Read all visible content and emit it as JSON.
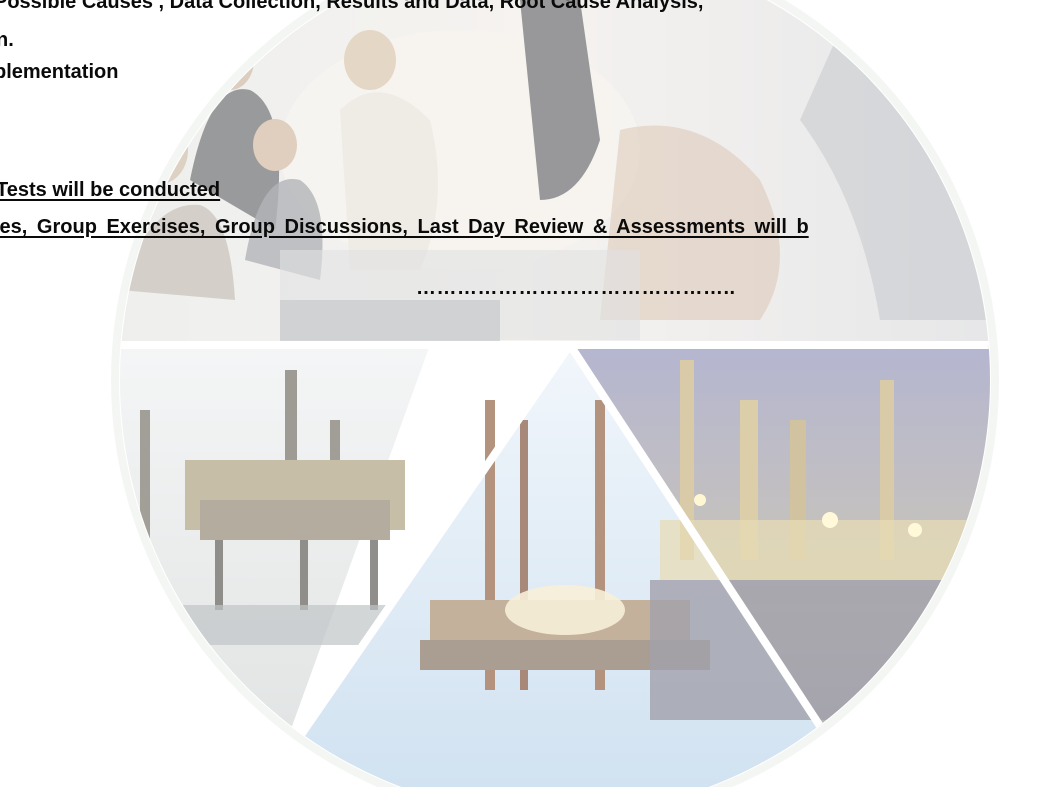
{
  "document": {
    "lines": [
      "Possible Causes , Data Collection, Results and Data, Root Cause Analysis,",
      "n.",
      "plementation",
      "Tests will be conducted",
      "ies, Group Exercises, Group Discussions, Last Day Review & Assessments will b"
    ],
    "separator": "……………………………………….."
  },
  "colors": {
    "text": "#0a0a0a",
    "sea_blue": "#b9d3ea",
    "sky_blue": "#dde9f5",
    "night_purple": "#6d6d9a"
  },
  "background_image": {
    "icons": [
      "office-meeting-photo-icon",
      "offshore-platform-photo-icon",
      "drilling-rig-photo-icon",
      "refinery-night-photo-icon"
    ]
  }
}
